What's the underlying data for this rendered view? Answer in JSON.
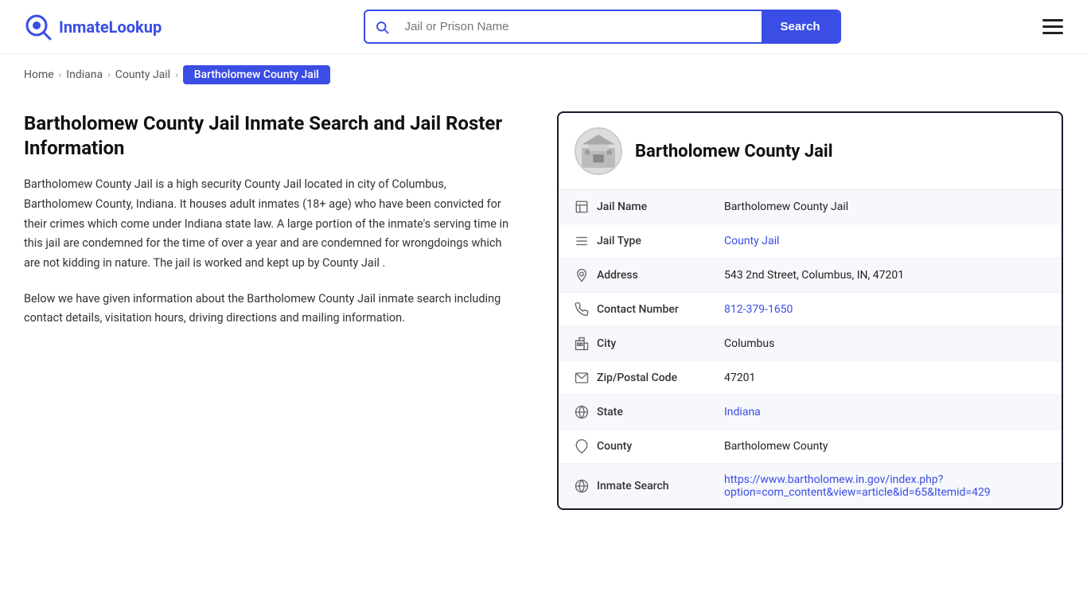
{
  "header": {
    "logo_text_part1": "Inmate",
    "logo_text_part2": "Lookup",
    "search_placeholder": "Jail or Prison Name",
    "search_button_label": "Search"
  },
  "breadcrumb": {
    "home": "Home",
    "indiana": "Indiana",
    "county_jail": "County Jail",
    "current": "Bartholomew County Jail"
  },
  "left": {
    "heading": "Bartholomew County Jail Inmate Search and Jail Roster Information",
    "description1": "Bartholomew County Jail is a high security County Jail located in city of Columbus, Bartholomew County, Indiana. It houses adult inmates (18+ age) who have been convicted for their crimes which come under Indiana state law. A large portion of the inmate's serving time in this jail are condemned for the time of over a year and are condemned for wrongdoings which are not kidding in nature. The jail is worked and kept up by County Jail .",
    "description2": "Below we have given information about the Bartholomew County Jail inmate search including contact details, visitation hours, driving directions and mailing information."
  },
  "card": {
    "title": "Bartholomew County Jail",
    "rows": [
      {
        "icon": "building-icon",
        "label": "Jail Name",
        "value": "Bartholomew County Jail",
        "link": null
      },
      {
        "icon": "list-icon",
        "label": "Jail Type",
        "value": "County Jail",
        "link": "#"
      },
      {
        "icon": "location-icon",
        "label": "Address",
        "value": "543 2nd Street, Columbus, IN, 47201",
        "link": null
      },
      {
        "icon": "phone-icon",
        "label": "Contact Number",
        "value": "812-379-1650",
        "link": "tel:812-379-1650"
      },
      {
        "icon": "city-icon",
        "label": "City",
        "value": "Columbus",
        "link": null
      },
      {
        "icon": "mail-icon",
        "label": "Zip/Postal Code",
        "value": "47201",
        "link": null
      },
      {
        "icon": "globe-icon",
        "label": "State",
        "value": "Indiana",
        "link": "#"
      },
      {
        "icon": "county-icon",
        "label": "County",
        "value": "Bartholomew County",
        "link": null
      },
      {
        "icon": "search-globe-icon",
        "label": "Inmate Search",
        "value": "https://www.bartholomew.in.gov/index.php?option=com_content&view=article&id=65&Itemid=429",
        "link": "https://www.bartholomew.in.gov/index.php?option=com_content&view=article&id=65&Itemid=429"
      }
    ]
  },
  "icons": {
    "building": "🏛",
    "list": "≡",
    "location": "📍",
    "phone": "📞",
    "city": "🏙",
    "mail": "✉",
    "globe": "🌐",
    "county": "🗂",
    "search_globe": "🌐"
  }
}
